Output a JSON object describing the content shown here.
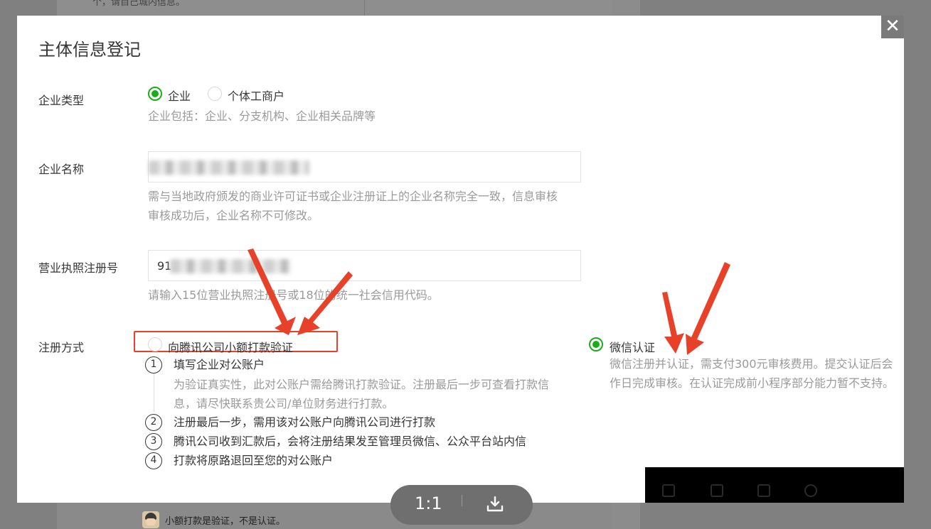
{
  "background": {
    "top_text": "个，请自己城内信息。",
    "comment": {
      "text": "小额打款是验证，不是认证。"
    }
  },
  "dialog": {
    "title": "主体信息登记",
    "close_icon": "close-icon",
    "enterprise_type": {
      "label": "企业类型",
      "options": [
        "企业",
        "个体工商户"
      ],
      "selected": "企业",
      "help": "企业包括：企业、分支机构、企业相关品牌等"
    },
    "enterprise_name": {
      "label": "企业名称",
      "value": "",
      "help_line1": "需与当地政府颁发的商业许可证书或企业注册证上的企业名称完全一致，信息审核",
      "help_line2": "审核成功后，企业名称不可修改。"
    },
    "license_number": {
      "label": "营业执照注册号",
      "value": "91",
      "help": "请输入15位营业执照注册号或18位的统一社会信用代码。"
    },
    "registration_method": {
      "label": "注册方式",
      "option_transfer": "向腾讯公司小额打款验证",
      "option_wechat": "微信认证",
      "selected": "微信认证",
      "transfer_steps": [
        {
          "num": "1",
          "text": "填写企业对公账户",
          "desc_line1": "为验证真实性，此对公账户需给腾讯打款验证。注册最后一步可查看打款信",
          "desc_line2": "息，请尽快联系贵公司/单位财务进行打款。"
        },
        {
          "num": "2",
          "text": "注册最后一步，需用该对公账户向腾讯公司进行打款"
        },
        {
          "num": "3",
          "text": "腾讯公司收到汇款后，会将注册结果发至管理员微信、公众平台站内信"
        },
        {
          "num": "4",
          "text": "打款将原路退回至您的对公账户"
        }
      ],
      "wechat_desc_line1": "微信注册并认证，需支付300元审核费用。提交认证后会",
      "wechat_desc_line2": "作日完成审核。在认证完成前小程序部分能力暂不支持。"
    }
  },
  "viewer_toolbar": {
    "zoom_label": "1:1",
    "download_icon": "download-icon"
  },
  "colors": {
    "accent_green": "#1aad19",
    "annotation_red": "#e8412a"
  }
}
